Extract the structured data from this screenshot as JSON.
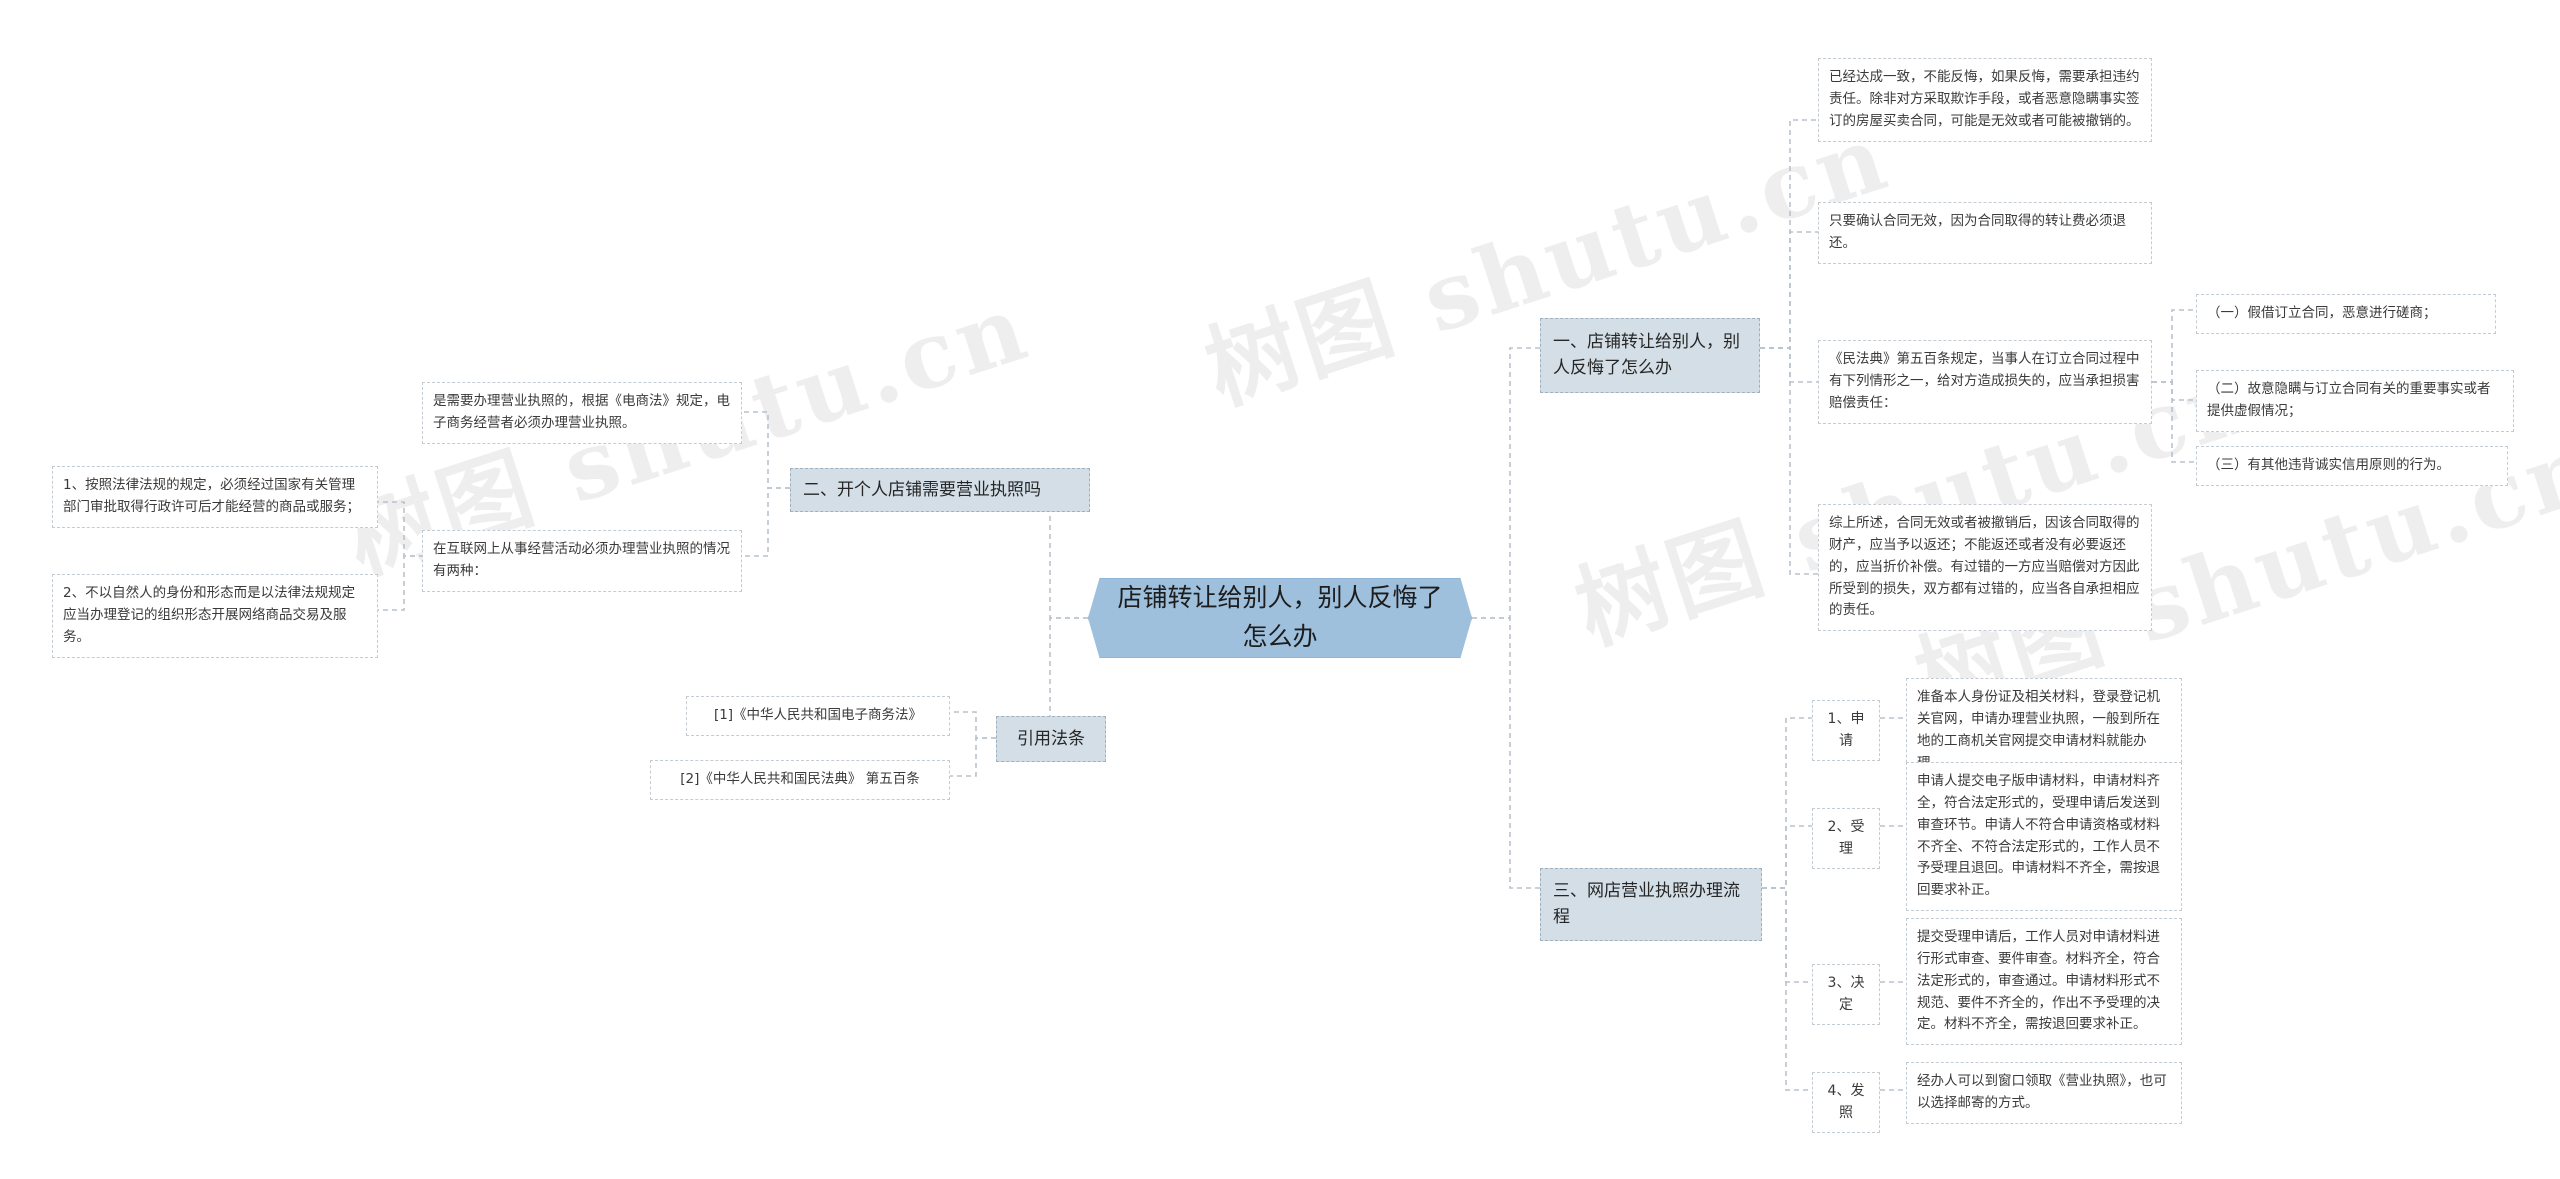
{
  "root": {
    "title": "店铺转让给别人，别人反悔了怎么办"
  },
  "watermarks": {
    "text_1": "树图 shutu.cn",
    "text_2": "树图 shutu.cn",
    "text_3": "树图 shutu.cn",
    "text_4": "树图 shutu.cn"
  },
  "branches": {
    "one": {
      "label": "一、店铺转让给别人，别人反悔了怎么办",
      "details": [
        "已经达成一致，不能反悔，如果反悔，需要承担违约责任。除非对方采取欺诈手段，或者恶意隐瞒事实签订的房屋买卖合同，可能是无效或者可能被撤销的。",
        "只要确认合同无效，因为合同取得的转让费必须退还。",
        "《民法典》第五百条规定，当事人在订立合同过程中有下列情形之一，给对方造成损失的，应当承担损害赔偿责任：",
        "综上所述，合同无效或者被撤销后，因该合同取得的财产，应当予以返还；不能返还或者没有必要返还的，应当折价补偿。有过错的一方应当赔偿对方因此所受到的损失，双方都有过错的，应当各自承担相应的责任。"
      ],
      "sub_items": [
        "（一）假借订立合同，恶意进行磋商；",
        "（二）故意隐瞒与订立合同有关的重要事实或者提供虚假情况；",
        "（三）有其他违背诚实信用原则的行为。"
      ]
    },
    "two": {
      "label": "二、开个人店铺需要营业执照吗",
      "details": [
        "是需要办理营业执照的，根据《电商法》规定，电子商务经营者必须办理营业执照。",
        "在互联网上从事经营活动必须办理营业执照的情况有两种："
      ],
      "sub_items": [
        "1、按照法律法规的规定，必须经过国家有关管理部门审批取得行政许可后才能经营的商品或服务；",
        "2、不以自然人的身份和形态而是以法律法规规定应当办理登记的组织形态开展网络商品交易及服务。"
      ]
    },
    "three": {
      "label": "三、网店营业执照办理流程",
      "steps": [
        {
          "label": "1、申请",
          "text": "准备本人身份证及相关材料，登录登记机关官网，申请办理营业执照，一般到所在地的工商机关官网提交申请材料就能办理。"
        },
        {
          "label": "2、受理",
          "text": "申请人提交电子版申请材料，申请材料齐全，符合法定形式的，受理申请后发送到审查环节。申请人不符合申请资格或材料不齐全、不符合法定形式的，工作人员不予受理且退回。申请材料不齐全，需按退回要求补正。"
        },
        {
          "label": "3、决定",
          "text": "提交受理申请后，工作人员对申请材料进行形式审查、要件审查。材料齐全，符合法定形式的，审查通过。申请材料形式不规范、要件不齐全的，作出不予受理的决定。材料不齐全，需按退回要求补正。"
        },
        {
          "label": "4、发照",
          "text": "经办人可以到窗口领取《营业执照》，也可以选择邮寄的方式。"
        }
      ]
    },
    "citations": {
      "label": "引用法条",
      "items": [
        "[1]《中华人民共和国电子商务法》",
        "[2]《中华人民共和国民法典》 第五百条"
      ]
    }
  },
  "colors": {
    "root_fill": "#9ec0dd",
    "branch_fill": "#d3dee6",
    "link_stroke": "#b9c2cc",
    "leaf_border": "#c3cbd3"
  }
}
